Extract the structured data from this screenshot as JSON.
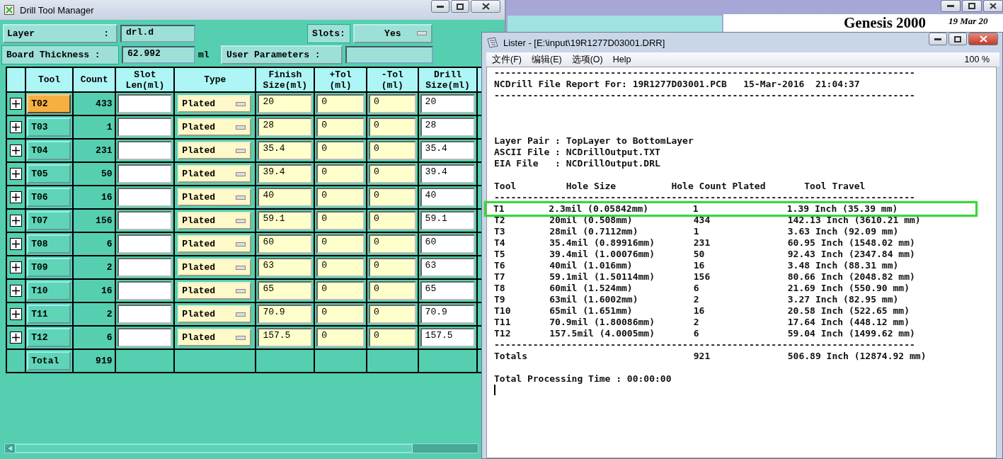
{
  "background_app": {
    "title": "Genesis 2000",
    "date": "19 Mar 20"
  },
  "drill_tool_manager": {
    "title": "Drill Tool Manager",
    "layer_label": "Layer",
    "layer_colon": ":",
    "layer_value": "drl.d",
    "slots_label": "Slots:",
    "slots_value": "Yes",
    "thickness_label": "Board Thickness :",
    "thickness_value": "62.992",
    "thickness_unit": "ml",
    "user_params_label": "User Parameters :",
    "columns": [
      {
        "lines": [
          "Tool"
        ]
      },
      {
        "lines": [
          "Count"
        ]
      },
      {
        "lines": [
          "Slot",
          "Len(ml)"
        ]
      },
      {
        "lines": [
          "Type"
        ]
      },
      {
        "lines": [
          "Finish",
          "Size(ml)"
        ]
      },
      {
        "lines": [
          "+Tol",
          "(ml)"
        ]
      },
      {
        "lines": [
          "-Tol",
          "(ml)"
        ]
      },
      {
        "lines": [
          "Drill",
          "Size(ml)"
        ]
      }
    ],
    "rows": [
      {
        "tool": "T02",
        "count": "433",
        "type": "Plated",
        "finish": "20",
        "plus_tol": "0",
        "minus_tol": "0",
        "drill": "20",
        "selected": true
      },
      {
        "tool": "T03",
        "count": "1",
        "type": "Plated",
        "finish": "28",
        "plus_tol": "0",
        "minus_tol": "0",
        "drill": "28",
        "selected": false
      },
      {
        "tool": "T04",
        "count": "231",
        "type": "Plated",
        "finish": "35.4",
        "plus_tol": "0",
        "minus_tol": "0",
        "drill": "35.4",
        "selected": false
      },
      {
        "tool": "T05",
        "count": "50",
        "type": "Plated",
        "finish": "39.4",
        "plus_tol": "0",
        "minus_tol": "0",
        "drill": "39.4",
        "selected": false
      },
      {
        "tool": "T06",
        "count": "16",
        "type": "Plated",
        "finish": "40",
        "plus_tol": "0",
        "minus_tol": "0",
        "drill": "40",
        "selected": false
      },
      {
        "tool": "T07",
        "count": "156",
        "type": "Plated",
        "finish": "59.1",
        "plus_tol": "0",
        "minus_tol": "0",
        "drill": "59.1",
        "selected": false
      },
      {
        "tool": "T08",
        "count": "6",
        "type": "Plated",
        "finish": "60",
        "plus_tol": "0",
        "minus_tol": "0",
        "drill": "60",
        "selected": false
      },
      {
        "tool": "T09",
        "count": "2",
        "type": "Plated",
        "finish": "63",
        "plus_tol": "0",
        "minus_tol": "0",
        "drill": "63",
        "selected": false
      },
      {
        "tool": "T10",
        "count": "16",
        "type": "Plated",
        "finish": "65",
        "plus_tol": "0",
        "minus_tol": "0",
        "drill": "65",
        "selected": false
      },
      {
        "tool": "T11",
        "count": "2",
        "type": "Plated",
        "finish": "70.9",
        "plus_tol": "0",
        "minus_tol": "0",
        "drill": "70.9",
        "selected": false
      },
      {
        "tool": "T12",
        "count": "6",
        "type": "Plated",
        "finish": "157.5",
        "plus_tol": "0",
        "minus_tol": "0",
        "drill": "157.5",
        "selected": false
      }
    ],
    "total": {
      "label": "Total",
      "count": "919"
    }
  },
  "lister": {
    "title": "Lister - [E:\\input\\19R1277D03001.DRR]",
    "menu": [
      "文件(F)",
      "编辑(E)",
      "选项(O)",
      "Help"
    ],
    "zoom": "100 %",
    "lines": [
      {
        "kind": "text",
        "text": "----------------------------------------------------------------------------"
      },
      {
        "kind": "text",
        "text": "NCDrill File Report For: 19R1277D03001.PCB   15-Mar-2016  21:04:37"
      },
      {
        "kind": "text",
        "text": "----------------------------------------------------------------------------"
      },
      {
        "kind": "blank"
      },
      {
        "kind": "blank"
      },
      {
        "kind": "blank"
      },
      {
        "kind": "text",
        "text": "Layer Pair : TopLayer to BottomLayer"
      },
      {
        "kind": "text",
        "text": "ASCII File : NCDrillOutput.TXT"
      },
      {
        "kind": "text",
        "text": "EIA File   : NCDrillOutput.DRL"
      },
      {
        "kind": "blank"
      },
      {
        "kind": "text",
        "text": "Tool         Hole Size          Hole Count Plated       Tool Travel"
      },
      {
        "kind": "text",
        "text": "----------------------------------------------------------------------------"
      },
      {
        "kind": "row",
        "cells": [
          "T1",
          "2.3mil (0.05842mm)",
          "1",
          "1.39 Inch (35.39 mm)"
        ],
        "highlighted": true
      },
      {
        "kind": "row",
        "cells": [
          "T2",
          "20mil (0.508mm)",
          "434",
          "142.13 Inch (3610.21 mm)"
        ],
        "highlighted": false
      },
      {
        "kind": "row",
        "cells": [
          "T3",
          "28mil (0.7112mm)",
          "1",
          "3.63 Inch (92.09 mm)"
        ],
        "highlighted": false
      },
      {
        "kind": "row",
        "cells": [
          "T4",
          "35.4mil (0.89916mm)",
          "231",
          "60.95 Inch (1548.02 mm)"
        ],
        "highlighted": false
      },
      {
        "kind": "row",
        "cells": [
          "T5",
          "39.4mil (1.00076mm)",
          "50",
          "92.43 Inch (2347.84 mm)"
        ],
        "highlighted": false
      },
      {
        "kind": "row",
        "cells": [
          "T6",
          "40mil (1.016mm)",
          "16",
          "3.48 Inch (88.31 mm)"
        ],
        "highlighted": false
      },
      {
        "kind": "row",
        "cells": [
          "T7",
          "59.1mil (1.50114mm)",
          "156",
          "80.66 Inch (2048.82 mm)"
        ],
        "highlighted": false
      },
      {
        "kind": "row",
        "cells": [
          "T8",
          "60mil (1.524mm)",
          "6",
          "21.69 Inch (550.90 mm)"
        ],
        "highlighted": false
      },
      {
        "kind": "row",
        "cells": [
          "T9",
          "63mil (1.6002mm)",
          "2",
          "3.27 Inch (82.95 mm)"
        ],
        "highlighted": false
      },
      {
        "kind": "row",
        "cells": [
          "T10",
          "65mil (1.651mm)",
          "16",
          "20.58 Inch (522.65 mm)"
        ],
        "highlighted": false
      },
      {
        "kind": "row",
        "cells": [
          "T11",
          "70.9mil (1.80086mm)",
          "2",
          "17.64 Inch (448.12 mm)"
        ],
        "highlighted": false
      },
      {
        "kind": "row",
        "cells": [
          "T12",
          "157.5mil (4.0005mm)",
          "6",
          "59.04 Inch (1499.62 mm)"
        ],
        "highlighted": false
      },
      {
        "kind": "text",
        "text": "----------------------------------------------------------------------------"
      },
      {
        "kind": "row",
        "cells": [
          "Totals",
          "",
          "921",
          "506.89 Inch (12874.92 mm)"
        ],
        "highlighted": false
      },
      {
        "kind": "blank"
      },
      {
        "kind": "text",
        "text": "Total Processing Time : 00:00:00"
      },
      {
        "kind": "cursor"
      }
    ]
  }
}
